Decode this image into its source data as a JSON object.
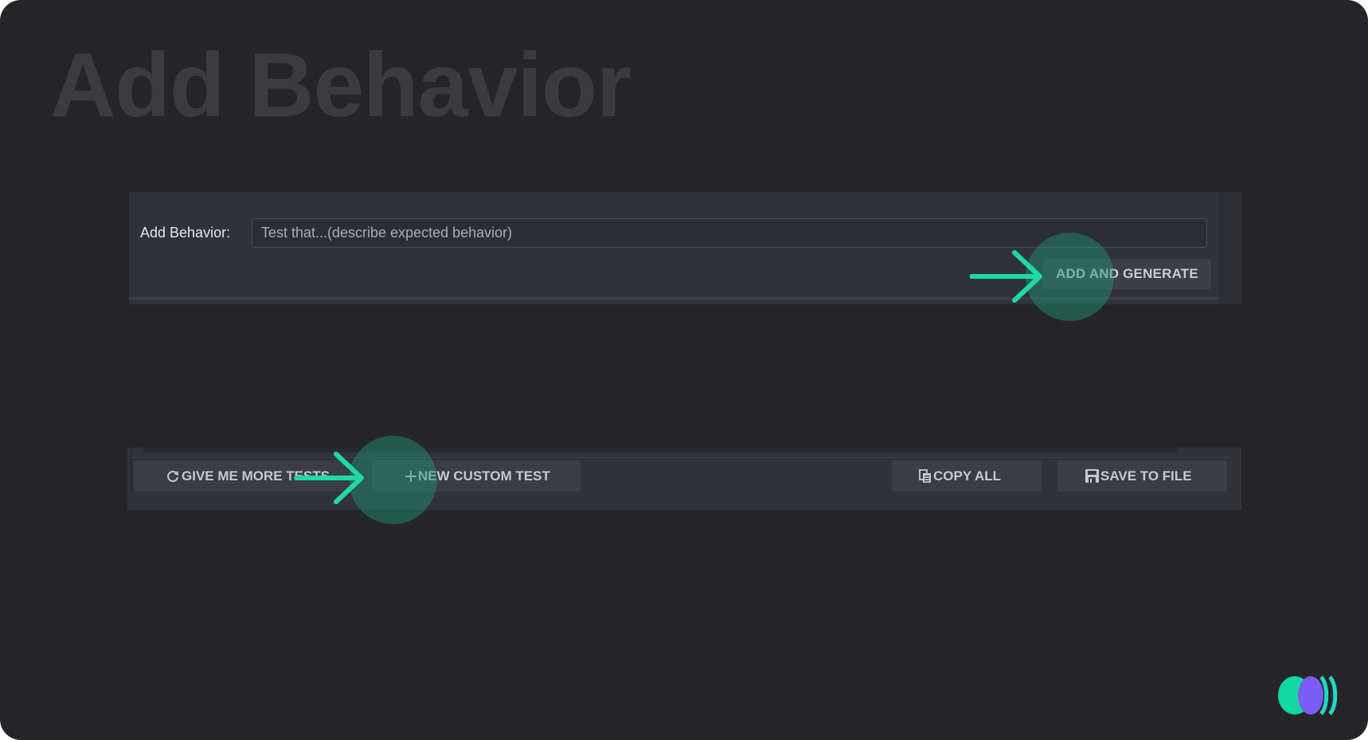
{
  "slide": {
    "title": "Add Behavior"
  },
  "behavior_panel": {
    "label": "Add Behavior:",
    "input_placeholder": "Test that...(describe expected behavior)",
    "input_value": "",
    "add_generate_label": "ADD AND GENERATE"
  },
  "toolbar": {
    "give_more_label": "GIVE ME MORE TESTS",
    "give_more_icon": "refresh-icon",
    "new_custom_label": "NEW CUSTOM TEST",
    "new_custom_icon": "plus-icon",
    "copy_all_label": "COPY ALL",
    "copy_all_icon": "copy-icon",
    "save_to_file_label": "SAVE TO FILE",
    "save_to_file_icon": "save-icon"
  },
  "annotations": {
    "highlight_color": "#1f9670",
    "arrow_color": "#1ed9a0",
    "targets": [
      "add-generate-button",
      "new-custom-test-button"
    ]
  },
  "brand": {
    "logo_icon": "brand-logo-icon",
    "colors": [
      "#12d9a3",
      "#7b5cf5",
      "#1ed9c8"
    ]
  },
  "colors": {
    "background": "#252528",
    "panel": "#30323a",
    "button": "#3a3d46",
    "text": "#c5c8cf"
  }
}
